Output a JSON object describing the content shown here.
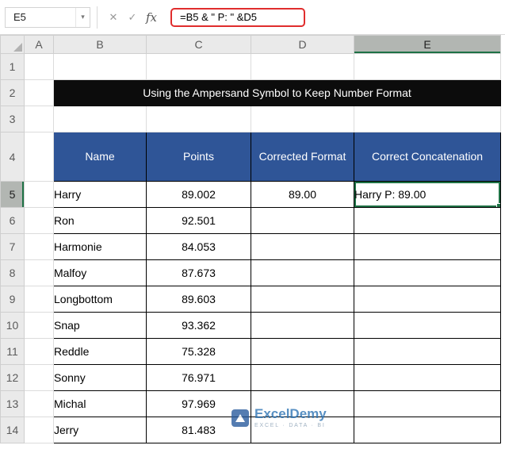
{
  "formula_bar": {
    "name_box": "E5",
    "formula": "=B5 & \" P: \" &D5"
  },
  "icons": {
    "dropdown": "▾",
    "cancel": "✕",
    "enter": "✓",
    "fx": "fx"
  },
  "grid": {
    "columns": [
      "A",
      "B",
      "C",
      "D",
      "E"
    ],
    "row_labels": [
      "1",
      "2",
      "3",
      "4",
      "5",
      "6",
      "7",
      "8",
      "9",
      "10",
      "11",
      "12",
      "13",
      "14"
    ]
  },
  "banner": {
    "text": "Using the Ampersand Symbol to Keep Number Format"
  },
  "table": {
    "headers": [
      "Name",
      "Points",
      "Corrected Format",
      "Correct Concatenation"
    ],
    "rows": [
      {
        "name": "Harry",
        "points": "89.002",
        "corrected": "89.00",
        "concat": "Harry  P: 89.00"
      },
      {
        "name": "Ron",
        "points": "92.501",
        "corrected": "",
        "concat": ""
      },
      {
        "name": "Harmonie",
        "points": "84.053",
        "corrected": "",
        "concat": ""
      },
      {
        "name": "Malfoy",
        "points": "87.673",
        "corrected": "",
        "concat": ""
      },
      {
        "name": "Longbottom",
        "points": "89.603",
        "corrected": "",
        "concat": ""
      },
      {
        "name": "Snap",
        "points": "93.362",
        "corrected": "",
        "concat": ""
      },
      {
        "name": "Reddle",
        "points": "75.328",
        "corrected": "",
        "concat": ""
      },
      {
        "name": "Sonny",
        "points": "76.971",
        "corrected": "",
        "concat": ""
      },
      {
        "name": "Michal",
        "points": "97.969",
        "corrected": "",
        "concat": ""
      },
      {
        "name": "Jerry",
        "points": "81.483",
        "corrected": "",
        "concat": ""
      }
    ]
  },
  "watermark": {
    "title": "ExcelDemy",
    "subtitle": "EXCEL · DATA · BI"
  },
  "colors": {
    "selection_green": "#1E7145",
    "table_header_blue": "#2F5597",
    "banner_black": "#0C0C0C",
    "formula_highlight_red": "#E02D2D",
    "watermark_blue": "#2F75B5"
  }
}
